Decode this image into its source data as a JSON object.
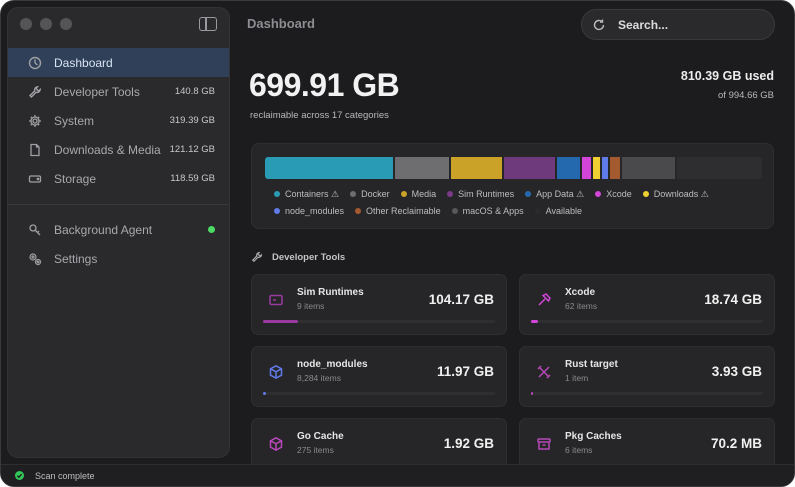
{
  "sidebar": {
    "items": [
      {
        "label": "Dashboard",
        "size": "",
        "icon": "gauge-icon",
        "active": true
      },
      {
        "label": "Developer Tools",
        "size": "140.8 GB",
        "icon": "wrench-icon"
      },
      {
        "label": "System",
        "size": "319.39 GB",
        "icon": "gear-icon"
      },
      {
        "label": "Downloads & Media",
        "size": "121.12 GB",
        "icon": "document-icon"
      },
      {
        "label": "Storage",
        "size": "118.59 GB",
        "icon": "drive-icon"
      }
    ],
    "secondary": [
      {
        "label": "Background Agent",
        "icon": "agent-icon",
        "status_color": "#4cd964"
      },
      {
        "label": "Settings",
        "icon": "gears-icon"
      }
    ]
  },
  "header": {
    "title": "Dashboard"
  },
  "search": {
    "placeholder": "Search..."
  },
  "summary": {
    "reclaimable": "699.91 GB",
    "reclaimable_sub": "reclaimable across 17 categories",
    "used": "810.39 GB used",
    "total": "of 994.66 GB"
  },
  "breakdown": {
    "segments": [
      {
        "name": "Containers",
        "fraction": 0.268,
        "color": "#2a9bb5"
      },
      {
        "name": "Docker",
        "fraction": 0.114,
        "color": "#6e6e70"
      },
      {
        "name": "Media",
        "fraction": 0.107,
        "color": "#c9a227"
      },
      {
        "name": "Sim Runtimes",
        "fraction": 0.107,
        "color": "#6f3a7c"
      },
      {
        "name": "App Data",
        "fraction": 0.048,
        "color": "#2469ad"
      },
      {
        "name": "Xcode",
        "fraction": 0.018,
        "color": "#d245d8"
      },
      {
        "name": "Downloads",
        "fraction": 0.016,
        "color": "#f0cf33"
      },
      {
        "name": "node_modules",
        "fraction": 0.012,
        "color": "#5f7be8"
      },
      {
        "name": "Other Reclaimable",
        "fraction": 0.02,
        "color": "#a35a2e"
      },
      {
        "name": "macOS & Apps",
        "fraction": 0.112,
        "color": "#4a4a4c"
      },
      {
        "name": "Available",
        "fraction": 0.178,
        "color": "#2e2e30"
      }
    ],
    "legend": [
      {
        "label": "Containers ⚠",
        "color": "#2a9bb5"
      },
      {
        "label": "Docker",
        "color": "#6e6e70"
      },
      {
        "label": "Media",
        "color": "#c9a227"
      },
      {
        "label": "Sim Runtimes",
        "color": "#7a3a88"
      },
      {
        "label": "App Data ⚠",
        "color": "#2469ad"
      },
      {
        "label": "Xcode",
        "color": "#d245d8"
      },
      {
        "label": "Downloads ⚠",
        "color": "#f0cf33"
      },
      {
        "label": "node_modules",
        "color": "#5f7be8"
      },
      {
        "label": "Other Reclaimable",
        "color": "#a35a2e"
      },
      {
        "label": "macOS & Apps",
        "color": "#58585a"
      },
      {
        "label": "Available",
        "color": "#2b2b2d"
      }
    ]
  },
  "developer_tools": {
    "title": "Developer Tools",
    "cards": [
      {
        "name": "Sim Runtimes",
        "count": "9 items",
        "size": "104.17 GB",
        "icon": "simulator-icon",
        "color": "#9a3aa0",
        "fraction": 0.15
      },
      {
        "name": "Xcode",
        "count": "62 items",
        "size": "18.74 GB",
        "icon": "hammer-icon",
        "color": "#d245d8",
        "fraction": 0.03
      },
      {
        "name": "node_modules",
        "count": "8,284 items",
        "size": "11.97 GB",
        "icon": "cube-icon",
        "color": "#5f7be8",
        "fraction": 0.015
      },
      {
        "name": "Rust target",
        "count": "1 item",
        "size": "3.93 GB",
        "icon": "tools-icon",
        "color": "#b548b8",
        "fraction": 0.008
      },
      {
        "name": "Go Cache",
        "count": "275 items",
        "size": "1.92 GB",
        "icon": "package-icon",
        "color": "#b548b8",
        "fraction": 0.005
      },
      {
        "name": "Pkg Caches",
        "count": "6 items",
        "size": "70.2 MB",
        "icon": "archive-icon",
        "color": "#b548b8",
        "fraction": 0.002
      }
    ]
  },
  "status": {
    "text": "Scan complete"
  }
}
